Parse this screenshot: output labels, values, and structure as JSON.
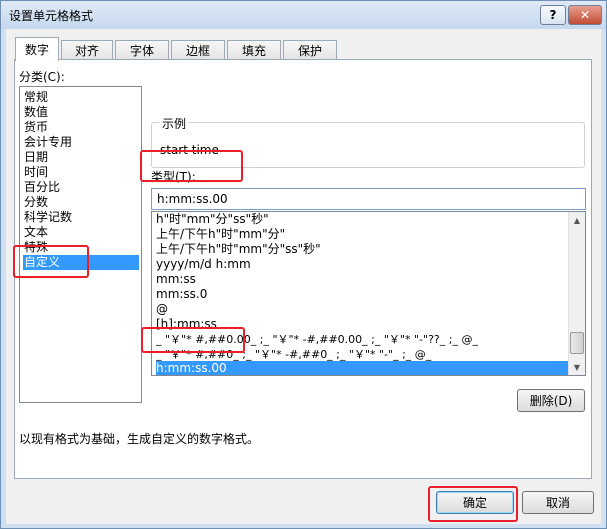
{
  "window": {
    "title": "设置单元格格式",
    "help_symbol": "?",
    "close_symbol": "✕"
  },
  "tabs": [
    {
      "label": "数字",
      "active": true
    },
    {
      "label": "对齐"
    },
    {
      "label": "字体"
    },
    {
      "label": "边框"
    },
    {
      "label": "填充"
    },
    {
      "label": "保护"
    }
  ],
  "category": {
    "label": "分类(C):",
    "items": [
      "常规",
      "数值",
      "货币",
      "会计专用",
      "日期",
      "时间",
      "百分比",
      "分数",
      "科学记数",
      "文本",
      "特殊",
      "自定义"
    ],
    "selected": "自定义"
  },
  "sample": {
    "legend": "示例",
    "value": "start time"
  },
  "type": {
    "label": "类型(T):",
    "value": "h:mm:ss.00",
    "items": [
      "h\"时\"mm\"分\"ss\"秒\"",
      "上午/下午h\"时\"mm\"分\"",
      "上午/下午h\"时\"mm\"分\"ss\"秒\"",
      "yyyy/m/d h:mm",
      "mm:ss",
      "mm:ss.0",
      "@",
      "[h]:mm:ss",
      "_ \"￥\"* #,##0.00_ ;_ \"￥\"* -#,##0.00_ ;_ \"￥\"* \"-\"??_ ;_ @_",
      "_ \"￥\"* #,##0_ ;_ \"￥\"* -#,##0_ ;_ \"￥\"* \"-\"_ ;_ @_",
      "h:mm:ss.00"
    ],
    "selected": "h:mm:ss.00"
  },
  "delete_button": "删除(D)",
  "description": "以现有格式为基础，生成自定义的数字格式。",
  "ok_button": "确定",
  "cancel_button": "取消",
  "highlight_color": "#e8202a",
  "selection_color": "#3399ff"
}
